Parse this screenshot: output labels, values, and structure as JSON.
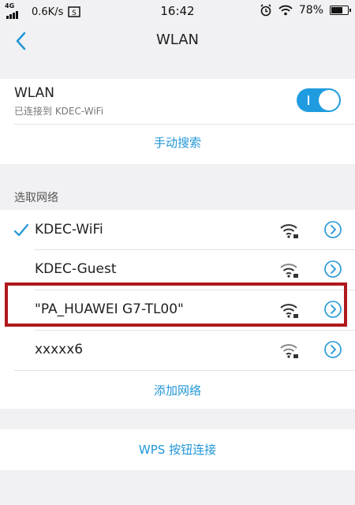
{
  "status_bar": {
    "network_type": "4G",
    "speed": "0.6K/s",
    "time": "16:42",
    "battery": "78%",
    "battery_level": 0.78
  },
  "nav": {
    "title": "WLAN"
  },
  "wlan_section": {
    "label": "WLAN",
    "sublabel": "已连接到 KDEC-WiFi",
    "toggle_on": true,
    "manual_search": "手动搜索"
  },
  "networks_section": {
    "label": "选取网络",
    "networks": [
      {
        "name": "KDEC-WiFi",
        "connected": true
      },
      {
        "name": "KDEC-Guest",
        "connected": false
      },
      {
        "name": "\"PA_HUAWEI G7-TL00\"",
        "connected": false
      },
      {
        "name": "xxxxx6",
        "connected": false
      }
    ],
    "add_network": "添加网络"
  },
  "wps": {
    "label": "WPS 按钮连接"
  },
  "colors": {
    "accent": "#2196d6",
    "toggle": "#1f9ce0",
    "highlight": "#b0181c"
  }
}
